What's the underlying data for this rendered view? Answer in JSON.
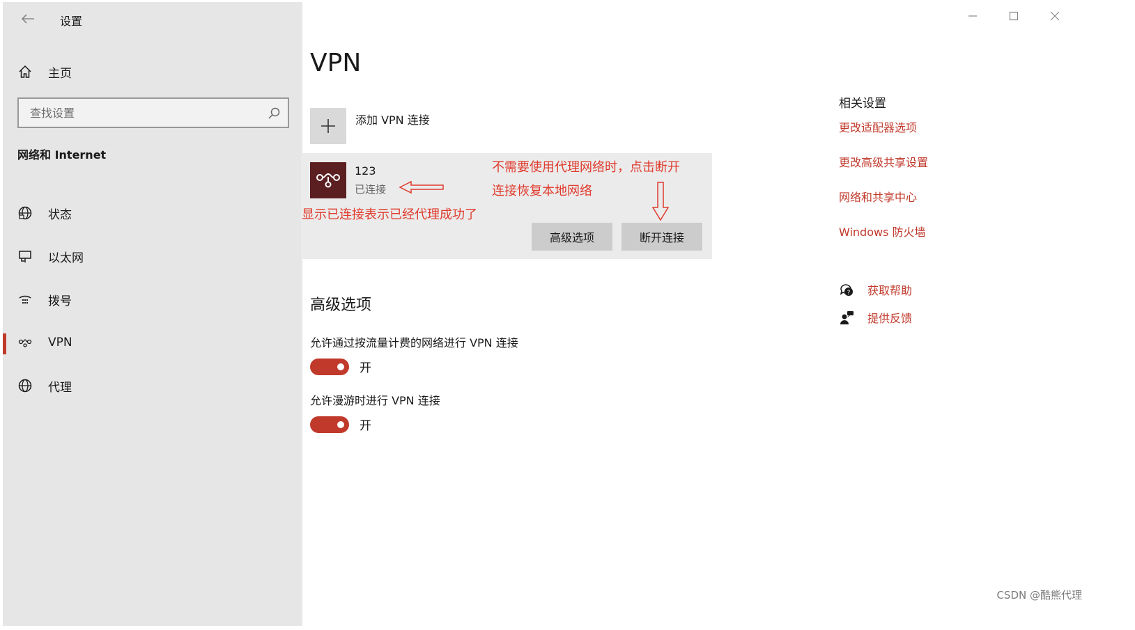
{
  "window": {
    "title": "设置",
    "controls": [
      "minimize-icon",
      "maximize-icon",
      "close-icon"
    ]
  },
  "sidebar": {
    "home_label": "主页",
    "search_placeholder": "查找设置",
    "section_heading": "网络和 Internet",
    "items": [
      {
        "label": "状态",
        "icon": "status-globe-icon"
      },
      {
        "label": "以太网",
        "icon": "ethernet-icon"
      },
      {
        "label": "拨号",
        "icon": "dialup-icon"
      },
      {
        "label": "VPN",
        "icon": "vpn-icon",
        "active": true
      },
      {
        "label": "代理",
        "icon": "proxy-globe-icon"
      }
    ]
  },
  "main": {
    "title": "VPN",
    "add_vpn_label": "添加 VPN 连接",
    "connection": {
      "name": "123",
      "status": "已连接",
      "advanced_button": "高级选项",
      "disconnect_button": "断开连接"
    },
    "advanced": {
      "heading": "高级选项",
      "options": [
        {
          "label": "允许通过按流量计费的网络进行 VPN 连接",
          "state": "开",
          "on": true
        },
        {
          "label": "允许漫游时进行 VPN 连接",
          "state": "开",
          "on": true
        }
      ]
    }
  },
  "related": {
    "heading": "相关设置",
    "links": [
      "更改适配器选项",
      "更改高级共享设置",
      "网络和共享中心",
      "Windows 防火墙"
    ],
    "help": [
      {
        "label": "获取帮助",
        "icon": "help-chat-icon"
      },
      {
        "label": "提供反馈",
        "icon": "feedback-icon"
      }
    ]
  },
  "annotations": {
    "tip_line1": "不需要使用代理网络时，点击断开",
    "tip_line2": "连接恢复本地网络",
    "connected_note": "显示已连接表示已经代理成功了"
  },
  "watermark": "CSDN @酷熊代理",
  "colors": {
    "accent": "#c0392b",
    "annotation": "#e03b2d",
    "sidebar_bg": "#e6e6e6",
    "card_bg": "#ebebeb",
    "vpn_logo_bg": "#5b1f22"
  }
}
